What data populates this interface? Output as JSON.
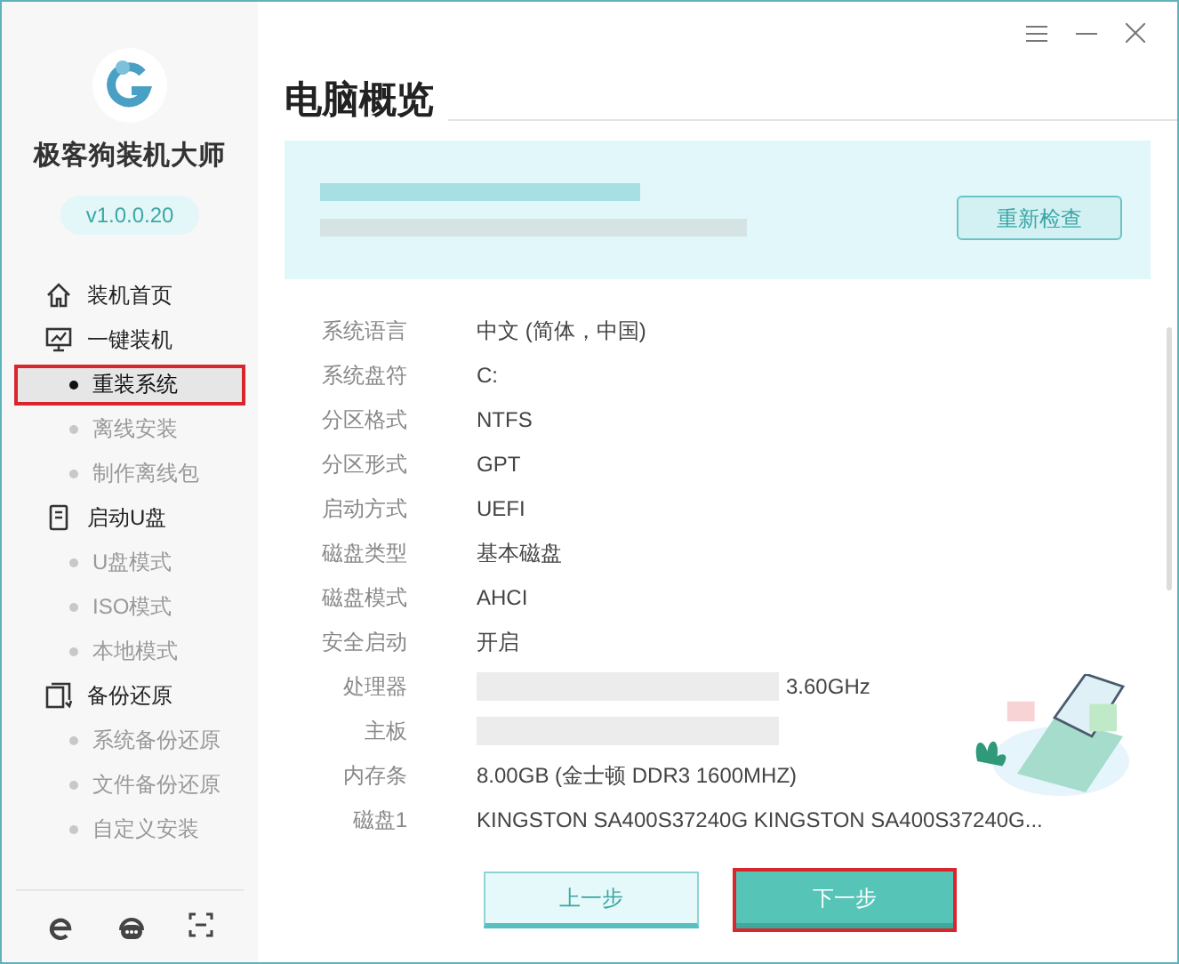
{
  "sidebar": {
    "app_name": "极客狗装机大师",
    "version": "v1.0.0.20",
    "nav": [
      {
        "label": "装机首页"
      },
      {
        "label": "一键装机",
        "children": [
          {
            "label": "重装系统",
            "selected": true
          },
          {
            "label": "离线安装",
            "selected": false
          },
          {
            "label": "制作离线包",
            "selected": false
          }
        ]
      },
      {
        "label": "启动U盘",
        "children": [
          {
            "label": "U盘模式",
            "selected": false
          },
          {
            "label": "ISO模式",
            "selected": false
          },
          {
            "label": "本地模式",
            "selected": false
          }
        ]
      },
      {
        "label": "备份还原",
        "children": [
          {
            "label": "系统备份还原",
            "selected": false
          },
          {
            "label": "文件备份还原",
            "selected": false
          },
          {
            "label": "自定义安装",
            "selected": false
          }
        ]
      }
    ]
  },
  "page": {
    "title": "电脑概览",
    "recheck_button": "重新检查",
    "rows": [
      {
        "label": "系统语言",
        "value": "中文 (简体，中国)"
      },
      {
        "label": "系统盘符",
        "value": "C:"
      },
      {
        "label": "分区格式",
        "value": "NTFS"
      },
      {
        "label": "分区形式",
        "value": "GPT"
      },
      {
        "label": "启动方式",
        "value": "UEFI"
      },
      {
        "label": "磁盘类型",
        "value": "基本磁盘"
      },
      {
        "label": "磁盘模式",
        "value": "AHCI"
      },
      {
        "label": "安全启动",
        "value": "开启"
      },
      {
        "label": "处理器",
        "value": "3.60GHz",
        "redacted": true
      },
      {
        "label": "主板",
        "redacted": true
      },
      {
        "label": "内存条",
        "value": "8.00GB (金士顿 DDR3 1600MHZ)"
      },
      {
        "label": "磁盘1",
        "value": "KINGSTON SA400S37240G KINGSTON SA400S37240G..."
      }
    ],
    "buttons": [
      {
        "label": "上一步",
        "kind": "secondary",
        "highlighted": false
      },
      {
        "label": "下一步",
        "kind": "primary",
        "highlighted": true
      }
    ]
  }
}
